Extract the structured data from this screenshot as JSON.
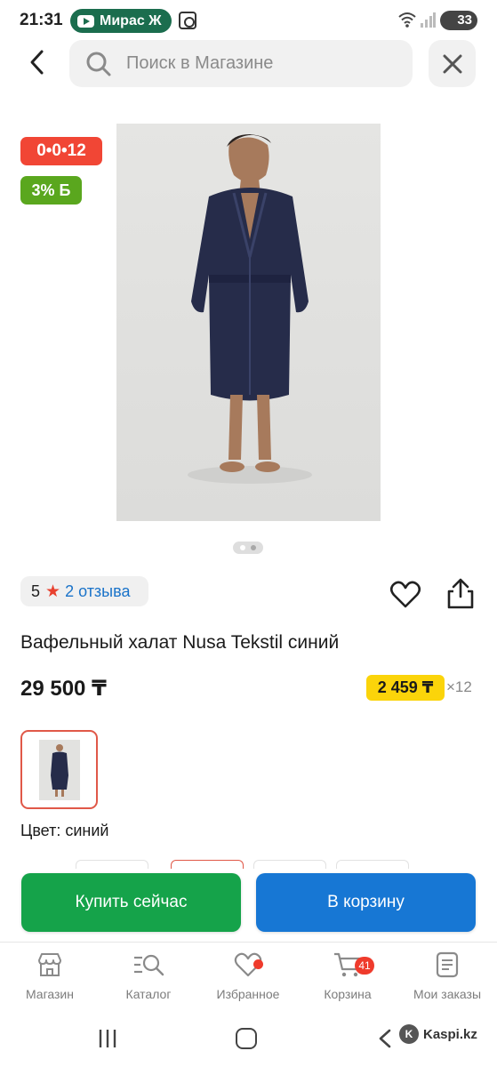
{
  "status_bar": {
    "time": "21:31",
    "youtube_pill_label": "Мирас Ж",
    "battery_level": "33"
  },
  "header": {
    "search_placeholder": "Поиск в Магазине",
    "back_icon": "chevron-left-icon",
    "search_icon": "search-icon",
    "close_icon": "close-icon"
  },
  "badges": {
    "installment": "0•0•12",
    "bonus": "3% Б"
  },
  "gallery": {
    "image_count": 2,
    "active_index": 0
  },
  "rating": {
    "score": "5",
    "reviews_label": "2 отзыва"
  },
  "product": {
    "title": "Вафельный халат Nusa Tekstil синий",
    "price": "29 500 ₸",
    "installment_price": "2 459 ₸",
    "installment_months": "×12",
    "color_label": "Цвет: синий"
  },
  "actions": {
    "buy_now": "Купить сейчас",
    "add_to_cart": "В корзину"
  },
  "bottom_nav": {
    "items": [
      {
        "label": "Магазин",
        "icon": "store-icon"
      },
      {
        "label": "Каталог",
        "icon": "catalog-search-icon"
      },
      {
        "label": "Избранное",
        "icon": "heart-icon"
      },
      {
        "label": "Корзина",
        "icon": "cart-icon",
        "badge": "41"
      },
      {
        "label": "Мои заказы",
        "icon": "orders-icon"
      }
    ]
  },
  "watermark": {
    "text": "Kaspi.kz"
  },
  "colors": {
    "installment_badge": "#f14635",
    "bonus_badge": "#5aa71e",
    "buy_button": "#15a34a",
    "cart_button": "#1777d4",
    "installment_chip": "#fbd40a",
    "link_blue": "#1a73c9"
  }
}
